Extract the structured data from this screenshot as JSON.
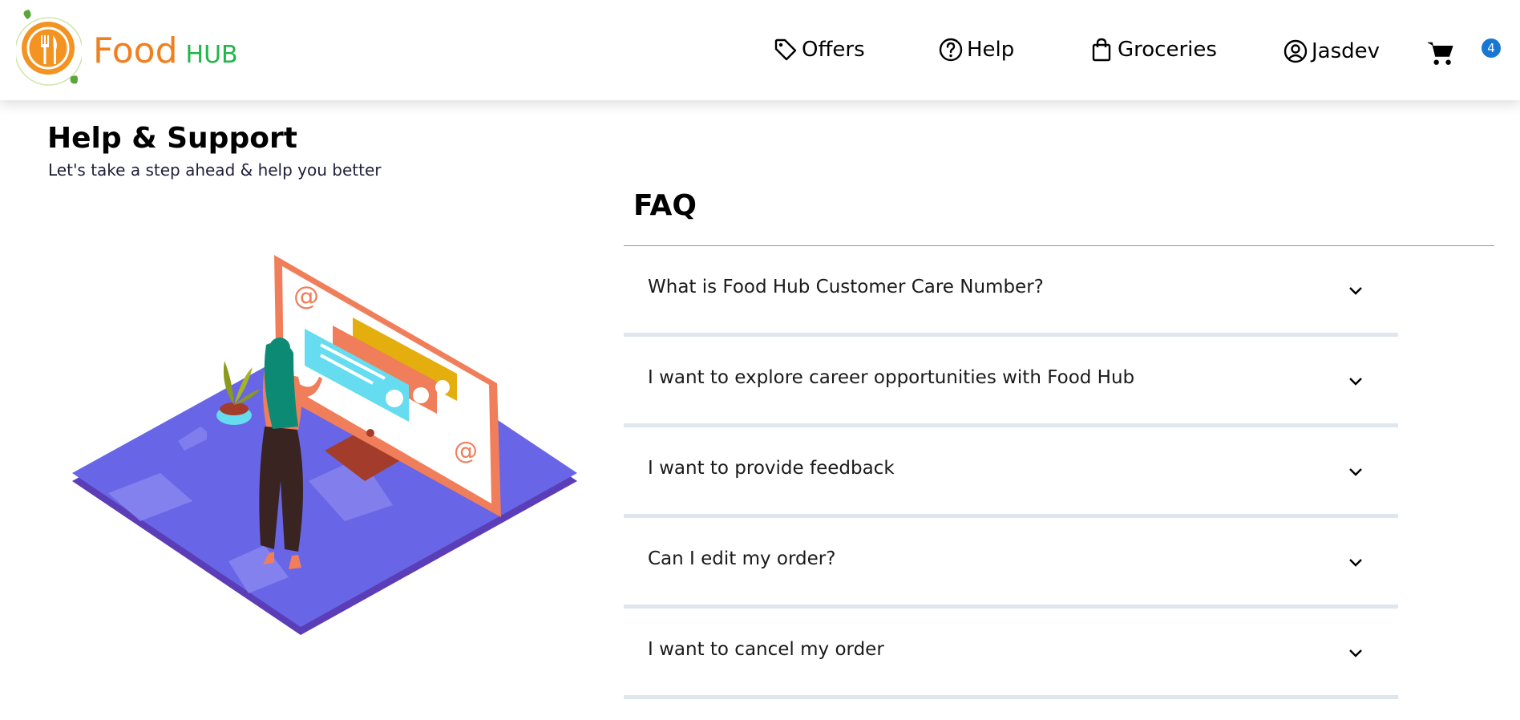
{
  "brand": {
    "name_primary": "Food",
    "name_secondary": "HUB",
    "primary_color": "#f0801f",
    "secondary_color": "#1fb64a"
  },
  "nav": {
    "items": [
      {
        "label": "Offers",
        "icon": "tag-icon"
      },
      {
        "label": "Help",
        "icon": "help-circle-icon"
      },
      {
        "label": "Groceries",
        "icon": "shopping-bag-icon"
      },
      {
        "label": "Jasdev",
        "icon": "user-circle-icon"
      }
    ],
    "cart": {
      "icon": "cart-icon",
      "count": "4",
      "badge_color": "#1976d2"
    }
  },
  "page": {
    "title": "Help & Support",
    "subtitle": "Let's take a step ahead & help you better"
  },
  "illustration": {
    "icon": "support-illustration",
    "symbol": "@"
  },
  "faq": {
    "title": "FAQ",
    "items": [
      {
        "question": "What is Food Hub Customer Care Number?"
      },
      {
        "question": "I want to explore career opportunities with Food Hub"
      },
      {
        "question": "I want to provide feedback"
      },
      {
        "question": "Can I edit my order?"
      },
      {
        "question": "I want to cancel my order"
      }
    ]
  }
}
